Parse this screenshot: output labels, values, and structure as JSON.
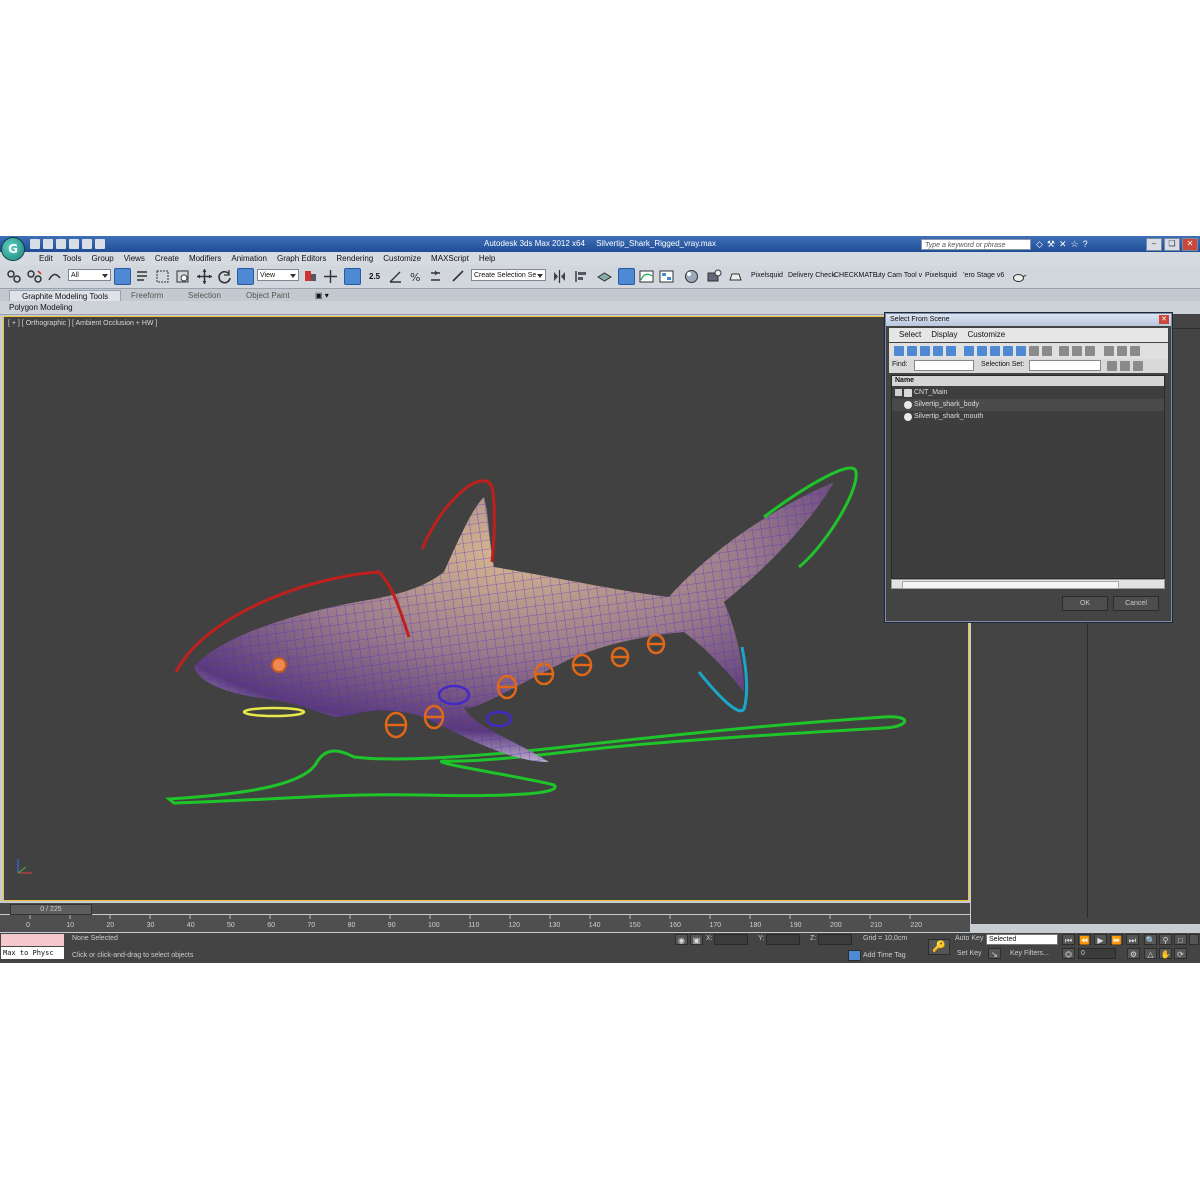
{
  "app": {
    "title": "Autodesk 3ds Max  2012 x64",
    "filename": "Silvertip_Shark_Rigged_vray.max",
    "logo_letter": "G",
    "search_placeholder": "Type a keyword or phrase"
  },
  "menu": [
    "Edit",
    "Tools",
    "Group",
    "Views",
    "Create",
    "Modifiers",
    "Animation",
    "Graph Editors",
    "Rendering",
    "Customize",
    "MAXScript",
    "Help"
  ],
  "toolbar": {
    "filter_select": "All",
    "coord_select": "View",
    "selection_set": "Create Selection Se",
    "spinner_label": "2.5",
    "plugins": [
      "Pixelsquid",
      "Delivery Check",
      "CHECKMATE",
      ".uty Cam Tool v",
      "Pixelsquid",
      "’ero Stage v6"
    ]
  },
  "ribbon": {
    "tabs": [
      "Graphite Modeling Tools",
      "Freeform",
      "Selection",
      "Object Paint"
    ],
    "panel_label": "Polygon Modeling"
  },
  "viewport": {
    "label": "[ + ] [ Orthographic ] [ Ambient Occlusion + HW ]"
  },
  "dialog": {
    "title": "Select From Scene",
    "menu": [
      "Select",
      "Display",
      "Customize"
    ],
    "find_label": "Find:",
    "selection_set_label": "Selection Set:",
    "column_header": "Name",
    "items": [
      "CNT_Main",
      "Silvertip_shark_body",
      "Silvertip_shark_mouth"
    ],
    "ok": "OK",
    "cancel": "Cancel"
  },
  "timeline": {
    "frame_display": "0 / 225",
    "ticks": [
      "0",
      "10",
      "20",
      "30",
      "40",
      "50",
      "60",
      "70",
      "80",
      "90",
      "100",
      "110",
      "120",
      "130",
      "140",
      "150",
      "160",
      "170",
      "180",
      "190",
      "200",
      "210",
      "220"
    ]
  },
  "status": {
    "selection": "None Selected",
    "prompt": "Click or click-and-drag to select objects",
    "listener": "Max to Physc",
    "x_label": "X:",
    "y_label": "Y:",
    "z_label": "Z:",
    "grid": "Grid = 10,0cm",
    "add_time_tag": "Add Time Tag",
    "auto_key": "Auto Key",
    "set_key": "Set Key",
    "key_mode": "Selected",
    "key_filters": "Key Filters...",
    "frame_field": "0"
  },
  "colors": {
    "viewport_bg": "#414141",
    "active_border": "#f2c230",
    "title_bar": "#2a5aa6",
    "control_green": "#1fc32a",
    "control_red": "#c0201c",
    "control_orange": "#e06818",
    "control_cyan": "#1aa6c8",
    "wire_purple": "#5a36d8"
  }
}
